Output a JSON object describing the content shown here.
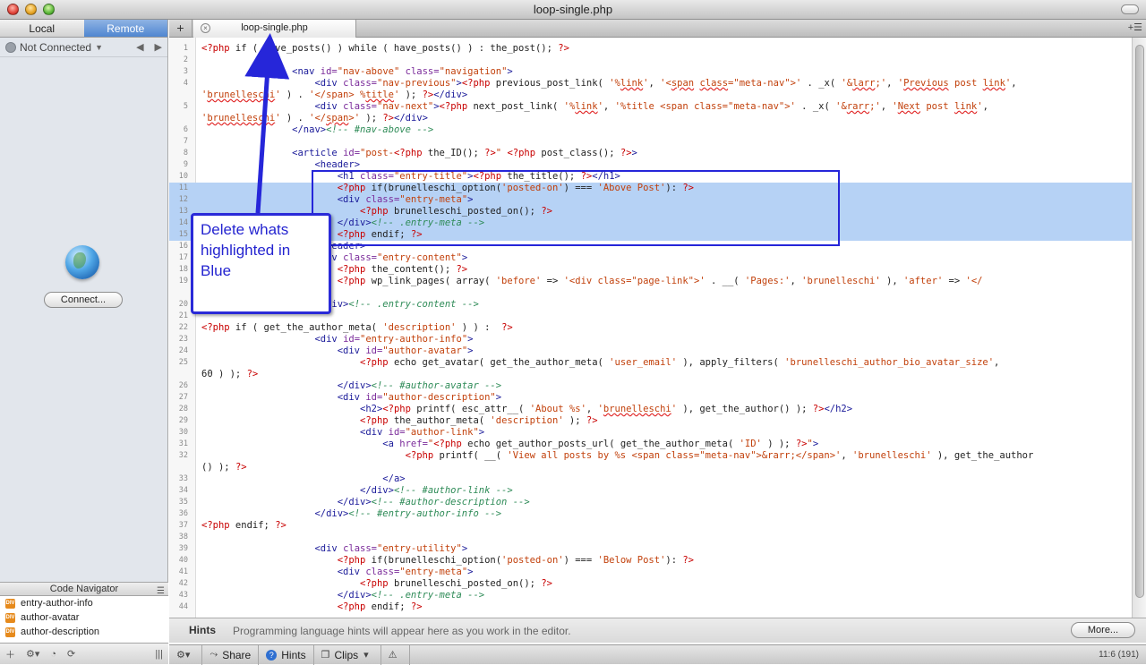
{
  "window": {
    "title": "loop-single.php"
  },
  "sidebar": {
    "tabs": [
      {
        "label": "Local",
        "active": false
      },
      {
        "label": "Remote",
        "active": true
      }
    ],
    "connection_status": "Not Connected",
    "connect_label": "Connect...",
    "code_navigator_title": "Code Navigator",
    "navigator_items": [
      "entry-author-info",
      "author-avatar",
      "author-description"
    ]
  },
  "tab": {
    "filename": "loop-single.php"
  },
  "annotation": {
    "callout": "Delete whats highlighted in Blue",
    "color": "#2626d9"
  },
  "editor": {
    "selected_lines": [
      11,
      12,
      13,
      14,
      15
    ],
    "selection_color": "#b6d2f5",
    "lines": [
      {
        "n": "1",
        "html": "<span class='p'>&lt;?php</span> if ( have_posts() ) while ( have_posts() ) : the_post(); <span class='p'>?&gt;</span>"
      },
      {
        "n": "2",
        "html": ""
      },
      {
        "n": "3",
        "html": "                <span class='t'>&lt;nav</span> <span class='a'>id=</span><span class='s'>\"nav-above\"</span> <span class='a'>class=</span><span class='s'>\"navigation\"</span><span class='t'>&gt;</span>"
      },
      {
        "n": "4",
        "html": "                    <span class='t'>&lt;div</span> <span class='a'>class=</span><span class='s'>\"nav-previous\"</span><span class='t'>&gt;</span><span class='p'>&lt;?php</span> previous_post_link( <span class='s'>'%<span class='w'>link</span>'</span>, <span class='s'>'&lt;<span class='w'>span</span> <span class='w'>class</span>=\"meta-nav\"&gt;'</span> . _x( <span class='s'>'&amp;<span class='w'>larr</span>;'</span>, <span class='s'>'<span class='w'>Previous</span> post <span class='w'>link</span>'</span>,"
      },
      {
        "n": "",
        "html": "<span class='s'>'<span class='w'>brunelleschi</span>'</span> ) . <span class='s'>'&lt;/span&gt; %<span class='w'>title</span>'</span> ); <span class='p'>?&gt;</span><span class='t'>&lt;/div&gt;</span>"
      },
      {
        "n": "5",
        "html": "                    <span class='t'>&lt;div</span> <span class='a'>class=</span><span class='s'>\"nav-next\"</span><span class='t'>&gt;</span><span class='p'>&lt;?php</span> next_post_link( <span class='s'>'%<span class='w'>link</span>'</span>, <span class='s'>'%title &lt;span class=\"meta-nav\"&gt;'</span> . _x( <span class='s'>'&amp;<span class='w'>rarr</span>;'</span>, <span class='s'>'<span class='w'>Next</span> post <span class='w'>link</span>'</span>,"
      },
      {
        "n": "",
        "html": "<span class='s'>'<span class='w'>brunelleschi</span>'</span> ) . <span class='s'>'&lt;/<span class='w'>span</span>&gt;'</span> ); <span class='p'>?&gt;</span><span class='t'>&lt;/div&gt;</span>"
      },
      {
        "n": "6",
        "html": "                <span class='t'>&lt;/nav&gt;</span><span class='c'>&lt;!-- #nav-above --&gt;</span>"
      },
      {
        "n": "7",
        "html": ""
      },
      {
        "n": "8",
        "html": "                <span class='t'>&lt;article</span> <span class='a'>id=</span><span class='s'>\"post-</span><span class='p'>&lt;?php</span> the_ID(); <span class='p'>?&gt;</span><span class='s'>\"</span> <span class='p'>&lt;?php</span> post_class(); <span class='p'>?&gt;</span><span class='t'>&gt;</span>"
      },
      {
        "n": "9",
        "html": "                    <span class='t'>&lt;header&gt;</span>"
      },
      {
        "n": "10",
        "html": "                        <span class='t'>&lt;h1</span> <span class='a'>class=</span><span class='s'>\"entry-title\"</span><span class='t'>&gt;</span><span class='p'>&lt;?php</span> the_title(); <span class='p'>?&gt;</span><span class='t'>&lt;/h1&gt;</span>"
      },
      {
        "n": "11",
        "html": "                        <span class='p'>&lt;?php</span> if(brunelleschi_option(<span class='s'>'posted-on'</span>) === <span class='s'>'Above Post'</span>): <span class='p'>?&gt;</span>"
      },
      {
        "n": "12",
        "html": "                        <span class='t'>&lt;div</span> <span class='a'>class=</span><span class='s'>\"entry-meta\"</span><span class='t'>&gt;</span>"
      },
      {
        "n": "13",
        "html": "                            <span class='p'>&lt;?php</span> brunelleschi_posted_on(); <span class='p'>?&gt;</span>"
      },
      {
        "n": "14",
        "html": "                        <span class='t'>&lt;/div&gt;</span><span class='c'>&lt;!-- .entry-meta --&gt;</span>"
      },
      {
        "n": "15",
        "html": "                        <span class='p'>&lt;?php</span> endif; <span class='p'>?&gt;</span>"
      },
      {
        "n": "16",
        "html": "                    <span class='t'>&lt;/header&gt;</span>"
      },
      {
        "n": "17",
        "html": "                    <span class='t'>&lt;div</span> <span class='a'>class=</span><span class='s'>\"entry-content\"</span><span class='t'>&gt;</span>"
      },
      {
        "n": "18",
        "html": "                        <span class='p'>&lt;?php</span> the_content(); <span class='p'>?&gt;</span>"
      },
      {
        "n": "19",
        "html": "                        <span class='p'>&lt;?php</span> wp_link_pages( array( <span class='s'>'before'</span> =&gt; <span class='s'>'&lt;div class=\"page-link\"&gt;'</span> . __( <span class='s'>'Pages:'</span>, <span class='s'>'brunelleschi'</span> ), <span class='s'>'after'</span> =&gt; <span class='s'>'&lt;/</span>"
      },
      {
        "n": "",
        "html": ""
      },
      {
        "n": "20",
        "html": "                    <span class='t'>&lt;/div&gt;</span><span class='c'>&lt;!-- .entry-content --&gt;</span>"
      },
      {
        "n": "21",
        "html": ""
      },
      {
        "n": "22",
        "html": "<span class='p'>&lt;?php</span> if ( get_the_author_meta( <span class='s'>'description'</span> ) ) :  <span class='p'>?&gt;</span>"
      },
      {
        "n": "23",
        "html": "                    <span class='t'>&lt;div</span> <span class='a'>id=</span><span class='s'>\"entry-author-info\"</span><span class='t'>&gt;</span>"
      },
      {
        "n": "24",
        "html": "                        <span class='t'>&lt;div</span> <span class='a'>id=</span><span class='s'>\"author-avatar\"</span><span class='t'>&gt;</span>"
      },
      {
        "n": "25",
        "html": "                            <span class='p'>&lt;?php</span> echo get_avatar( get_the_author_meta( <span class='s'>'user_email'</span> ), apply_filters( <span class='s'>'brunelleschi_author_bio_avatar_size'</span>,"
      },
      {
        "n": "",
        "html": "60 ) ); <span class='p'>?&gt;</span>"
      },
      {
        "n": "26",
        "html": "                        <span class='t'>&lt;/div&gt;</span><span class='c'>&lt;!-- #author-avatar --&gt;</span>"
      },
      {
        "n": "27",
        "html": "                        <span class='t'>&lt;div</span> <span class='a'>id=</span><span class='s'>\"author-description\"</span><span class='t'>&gt;</span>"
      },
      {
        "n": "28",
        "html": "                            <span class='t'>&lt;h2&gt;</span><span class='p'>&lt;?php</span> printf( esc_attr__( <span class='s'>'About %s'</span>, <span class='s'>'<span class='w'>brunelleschi</span>'</span> ), get_the_author() ); <span class='p'>?&gt;</span><span class='t'>&lt;/h2&gt;</span>"
      },
      {
        "n": "29",
        "html": "                            <span class='p'>&lt;?php</span> the_author_meta( <span class='s'>'description'</span> ); <span class='p'>?&gt;</span>"
      },
      {
        "n": "30",
        "html": "                            <span class='t'>&lt;div</span> <span class='a'>id=</span><span class='s'>\"author-link\"</span><span class='t'>&gt;</span>"
      },
      {
        "n": "31",
        "html": "                                <span class='t'>&lt;a</span> <span class='a'>href=</span><span class='s'>\"</span><span class='p'>&lt;?php</span> echo get_author_posts_url( get_the_author_meta( <span class='s'>'ID'</span> ) ); <span class='p'>?&gt;</span><span class='s'>\"</span><span class='t'>&gt;</span>"
      },
      {
        "n": "32",
        "html": "                                    <span class='p'>&lt;?php</span> printf( __( <span class='s'>'View all posts by %s &lt;span class=\"meta-nav\"&gt;&amp;rarr;&lt;/span&gt;'</span>, <span class='s'>'brunelleschi'</span> ), get_the_author"
      },
      {
        "n": "",
        "html": "() ); <span class='p'>?&gt;</span>"
      },
      {
        "n": "33",
        "html": "                                <span class='t'>&lt;/a&gt;</span>"
      },
      {
        "n": "34",
        "html": "                            <span class='t'>&lt;/div&gt;</span><span class='c'>&lt;!-- #author-link --&gt;</span>"
      },
      {
        "n": "35",
        "html": "                        <span class='t'>&lt;/div&gt;</span><span class='c'>&lt;!-- #author-description --&gt;</span>"
      },
      {
        "n": "36",
        "html": "                    <span class='t'>&lt;/div&gt;</span><span class='c'>&lt;!-- #entry-author-info --&gt;</span>"
      },
      {
        "n": "37",
        "html": "<span class='p'>&lt;?php</span> endif; <span class='p'>?&gt;</span>"
      },
      {
        "n": "38",
        "html": ""
      },
      {
        "n": "39",
        "html": "                    <span class='t'>&lt;div</span> <span class='a'>class=</span><span class='s'>\"entry-utility\"</span><span class='t'>&gt;</span>"
      },
      {
        "n": "40",
        "html": "                        <span class='p'>&lt;?php</span> if(brunelleschi_option(<span class='s'>'posted-on'</span>) === <span class='s'>'Below Post'</span>): <span class='p'>?&gt;</span>"
      },
      {
        "n": "41",
        "html": "                        <span class='t'>&lt;div</span> <span class='a'>class=</span><span class='s'>\"entry-meta\"</span><span class='t'>&gt;</span>"
      },
      {
        "n": "42",
        "html": "                            <span class='p'>&lt;?php</span> brunelleschi_posted_on(); <span class='p'>?&gt;</span>"
      },
      {
        "n": "43",
        "html": "                        <span class='t'>&lt;/div&gt;</span><span class='c'>&lt;!-- .entry-meta --&gt;</span>"
      },
      {
        "n": "44",
        "html": "                        <span class='p'>&lt;?php</span> endif; <span class='p'>?&gt;</span>"
      }
    ]
  },
  "hints": {
    "label": "Hints",
    "text": "Programming language hints will appear here as you work in the editor.",
    "more_label": "More..."
  },
  "statusbar": {
    "share": "Share",
    "hints": "Hints",
    "clips": "Clips",
    "cursor": "11:6 (191)"
  }
}
